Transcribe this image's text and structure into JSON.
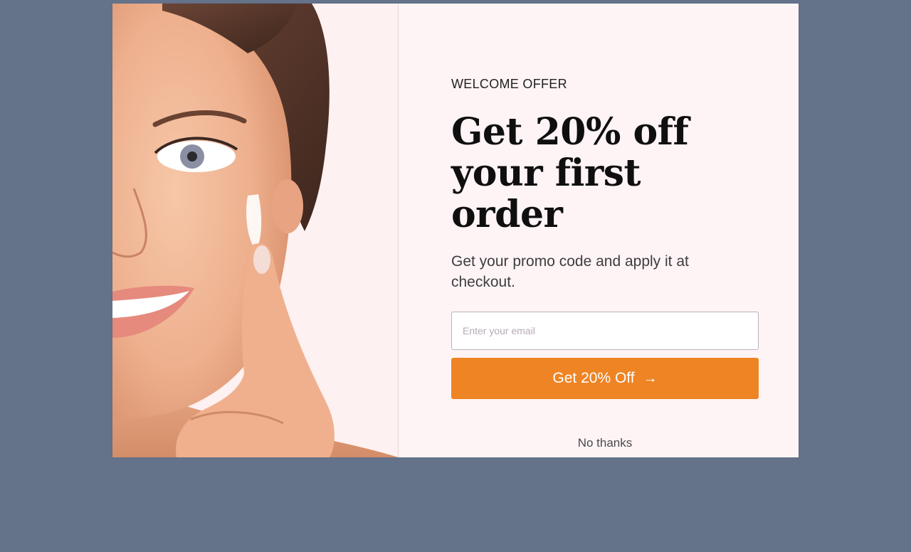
{
  "popup": {
    "eyebrow": "WELCOME OFFER",
    "headline": "Get 20% off your first order",
    "subtext": "Get your promo code and apply it at checkout.",
    "email_placeholder": "Enter your email",
    "cta_label": "Get 20% Off",
    "cta_icon": "arrow-right-icon",
    "dismiss_label": "No thanks"
  },
  "colors": {
    "backdrop": "#64728a",
    "modal_background": "#fff4f5",
    "cta_background": "#ee8424",
    "cta_text": "#ffffff",
    "headline": "#0f0f10"
  }
}
